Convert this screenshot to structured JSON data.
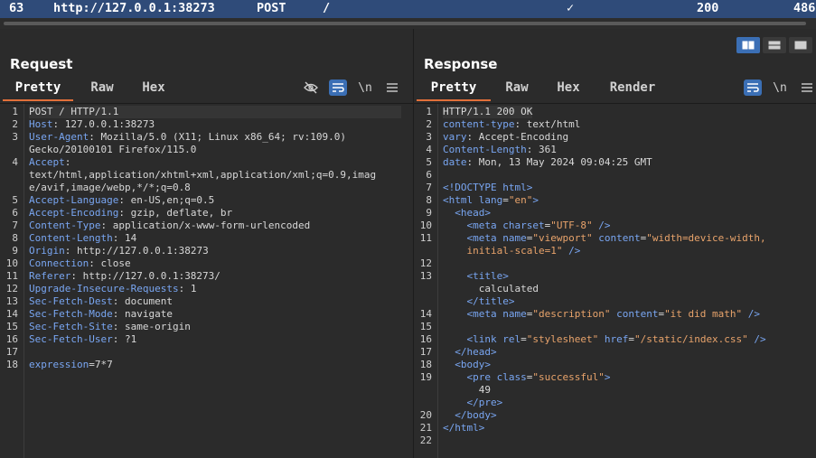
{
  "history_row": {
    "id": "63",
    "host": "http://127.0.0.1:38273",
    "method": "POST",
    "url": "/",
    "edited": "✓",
    "status": "200",
    "length": "486"
  },
  "request": {
    "title": "Request",
    "tabs": [
      "Pretty",
      "Raw",
      "Hex"
    ],
    "active_tab": "Pretty",
    "lines": [
      {
        "n": "1",
        "k": "",
        "v": "POST / HTTP/1.1",
        "hl": true
      },
      {
        "n": "2",
        "k": "Host",
        "v": "127.0.0.1:38273"
      },
      {
        "n": "3",
        "k": "User-Agent",
        "v": "Mozilla/5.0 (X11; Linux x86_64; rv:109.0)"
      },
      {
        "n": "",
        "k": "",
        "v": "Gecko/20100101 Firefox/115.0"
      },
      {
        "n": "4",
        "k": "Accept",
        "v": ""
      },
      {
        "n": "",
        "k": "",
        "v": "text/html,application/xhtml+xml,application/xml;q=0.9,imag"
      },
      {
        "n": "",
        "k": "",
        "v": "e/avif,image/webp,*/*;q=0.8"
      },
      {
        "n": "5",
        "k": "Accept-Language",
        "v": "en-US,en;q=0.5"
      },
      {
        "n": "6",
        "k": "Accept-Encoding",
        "v": "gzip, deflate, br"
      },
      {
        "n": "7",
        "k": "Content-Type",
        "v": "application/x-www-form-urlencoded"
      },
      {
        "n": "8",
        "k": "Content-Length",
        "v": "14"
      },
      {
        "n": "9",
        "k": "Origin",
        "v": "http://127.0.0.1:38273"
      },
      {
        "n": "10",
        "k": "Connection",
        "v": "close"
      },
      {
        "n": "11",
        "k": "Referer",
        "v": "http://127.0.0.1:38273/"
      },
      {
        "n": "12",
        "k": "Upgrade-Insecure-Requests",
        "v": "1"
      },
      {
        "n": "13",
        "k": "Sec-Fetch-Dest",
        "v": "document"
      },
      {
        "n": "14",
        "k": "Sec-Fetch-Mode",
        "v": "navigate"
      },
      {
        "n": "15",
        "k": "Sec-Fetch-Site",
        "v": "same-origin"
      },
      {
        "n": "16",
        "k": "Sec-Fetch-User",
        "v": "?1"
      },
      {
        "n": "17",
        "k": "",
        "v": ""
      },
      {
        "n": "18",
        "body": true,
        "k": "expression",
        "v": "7*7"
      }
    ]
  },
  "response": {
    "title": "Response",
    "tabs": [
      "Pretty",
      "Raw",
      "Hex",
      "Render"
    ],
    "active_tab": "Pretty",
    "lines": [
      {
        "n": "1",
        "t": [
          [
            "txt",
            "HTTP/1.1 200 OK"
          ]
        ],
        "hl": true
      },
      {
        "n": "2",
        "t": [
          [
            "key",
            "content-type"
          ],
          [
            "txt",
            ": text/html"
          ]
        ]
      },
      {
        "n": "3",
        "t": [
          [
            "key",
            "vary"
          ],
          [
            "txt",
            ": Accept-Encoding"
          ]
        ]
      },
      {
        "n": "4",
        "t": [
          [
            "key",
            "Content-Length"
          ],
          [
            "txt",
            ": 361"
          ]
        ]
      },
      {
        "n": "5",
        "t": [
          [
            "key",
            "date"
          ],
          [
            "txt",
            ": Mon, 13 May 2024 09:04:25 GMT"
          ]
        ]
      },
      {
        "n": "6",
        "t": []
      },
      {
        "n": "7",
        "t": [
          [
            "tag",
            "<!DOCTYPE html>"
          ]
        ]
      },
      {
        "n": "8",
        "t": [
          [
            "tag",
            "<html "
          ],
          [
            "key",
            "lang"
          ],
          [
            "txt",
            "="
          ],
          [
            "str",
            "\"en\""
          ],
          [
            "tag",
            ">"
          ]
        ]
      },
      {
        "n": "9",
        "t": [
          [
            "tag",
            "  <head>"
          ]
        ]
      },
      {
        "n": "10",
        "t": [
          [
            "tag",
            "    <meta "
          ],
          [
            "key",
            "charset"
          ],
          [
            "txt",
            "="
          ],
          [
            "str",
            "\"UTF-8\""
          ],
          [
            "tag",
            " />"
          ]
        ]
      },
      {
        "n": "11",
        "t": [
          [
            "tag",
            "    <meta "
          ],
          [
            "key",
            "name"
          ],
          [
            "txt",
            "="
          ],
          [
            "str",
            "\"viewport\""
          ],
          [
            "txt",
            " "
          ],
          [
            "key",
            "content"
          ],
          [
            "txt",
            "="
          ],
          [
            "str",
            "\"width=device-width,"
          ]
        ]
      },
      {
        "n": "",
        "t": [
          [
            "str",
            "    initial-scale=1\""
          ],
          [
            "tag",
            " />"
          ]
        ]
      },
      {
        "n": "12",
        "t": []
      },
      {
        "n": "13",
        "t": [
          [
            "tag",
            "    <title>"
          ]
        ]
      },
      {
        "n": "",
        "t": [
          [
            "txt",
            "      calculated"
          ]
        ]
      },
      {
        "n": "",
        "t": [
          [
            "tag",
            "    </title>"
          ]
        ]
      },
      {
        "n": "14",
        "t": [
          [
            "tag",
            "    <meta "
          ],
          [
            "key",
            "name"
          ],
          [
            "txt",
            "="
          ],
          [
            "str",
            "\"description\""
          ],
          [
            "txt",
            " "
          ],
          [
            "key",
            "content"
          ],
          [
            "txt",
            "="
          ],
          [
            "str",
            "\"it did math\""
          ],
          [
            "tag",
            " />"
          ]
        ]
      },
      {
        "n": "15",
        "t": []
      },
      {
        "n": "16",
        "t": [
          [
            "tag",
            "    <link "
          ],
          [
            "key",
            "rel"
          ],
          [
            "txt",
            "="
          ],
          [
            "str",
            "\"stylesheet\""
          ],
          [
            "txt",
            " "
          ],
          [
            "key",
            "href"
          ],
          [
            "txt",
            "="
          ],
          [
            "str",
            "\"/static/index.css\""
          ],
          [
            "tag",
            " />"
          ]
        ]
      },
      {
        "n": "17",
        "t": [
          [
            "tag",
            "  </head>"
          ]
        ]
      },
      {
        "n": "18",
        "t": [
          [
            "tag",
            "  <body>"
          ]
        ]
      },
      {
        "n": "19",
        "t": [
          [
            "tag",
            "    <pre "
          ],
          [
            "key",
            "class"
          ],
          [
            "txt",
            "="
          ],
          [
            "str",
            "\"successful\""
          ],
          [
            "tag",
            ">"
          ]
        ]
      },
      {
        "n": "",
        "t": [
          [
            "txt",
            "      49"
          ]
        ]
      },
      {
        "n": "",
        "t": [
          [
            "tag",
            "    </pre>"
          ]
        ]
      },
      {
        "n": "20",
        "t": [
          [
            "tag",
            "  </body>"
          ]
        ]
      },
      {
        "n": "21",
        "t": [
          [
            "tag",
            "</html>"
          ]
        ]
      },
      {
        "n": "22",
        "t": []
      }
    ]
  },
  "icons": {
    "hide": "eye-slash-icon",
    "wrap": "word-wrap-icon",
    "newline": "\\n",
    "menu": "hamburger-menu-icon",
    "layout_split_h": "split-horizontal-icon",
    "layout_split_v": "split-vertical-icon",
    "layout_single": "single-pane-icon"
  },
  "colors": {
    "accent_tab": "#e2703a",
    "selected_row": "#2f4b79",
    "header_key": "#79a6f2",
    "attr_value": "#e8a36b",
    "active_tool": "#3b6fb5"
  }
}
